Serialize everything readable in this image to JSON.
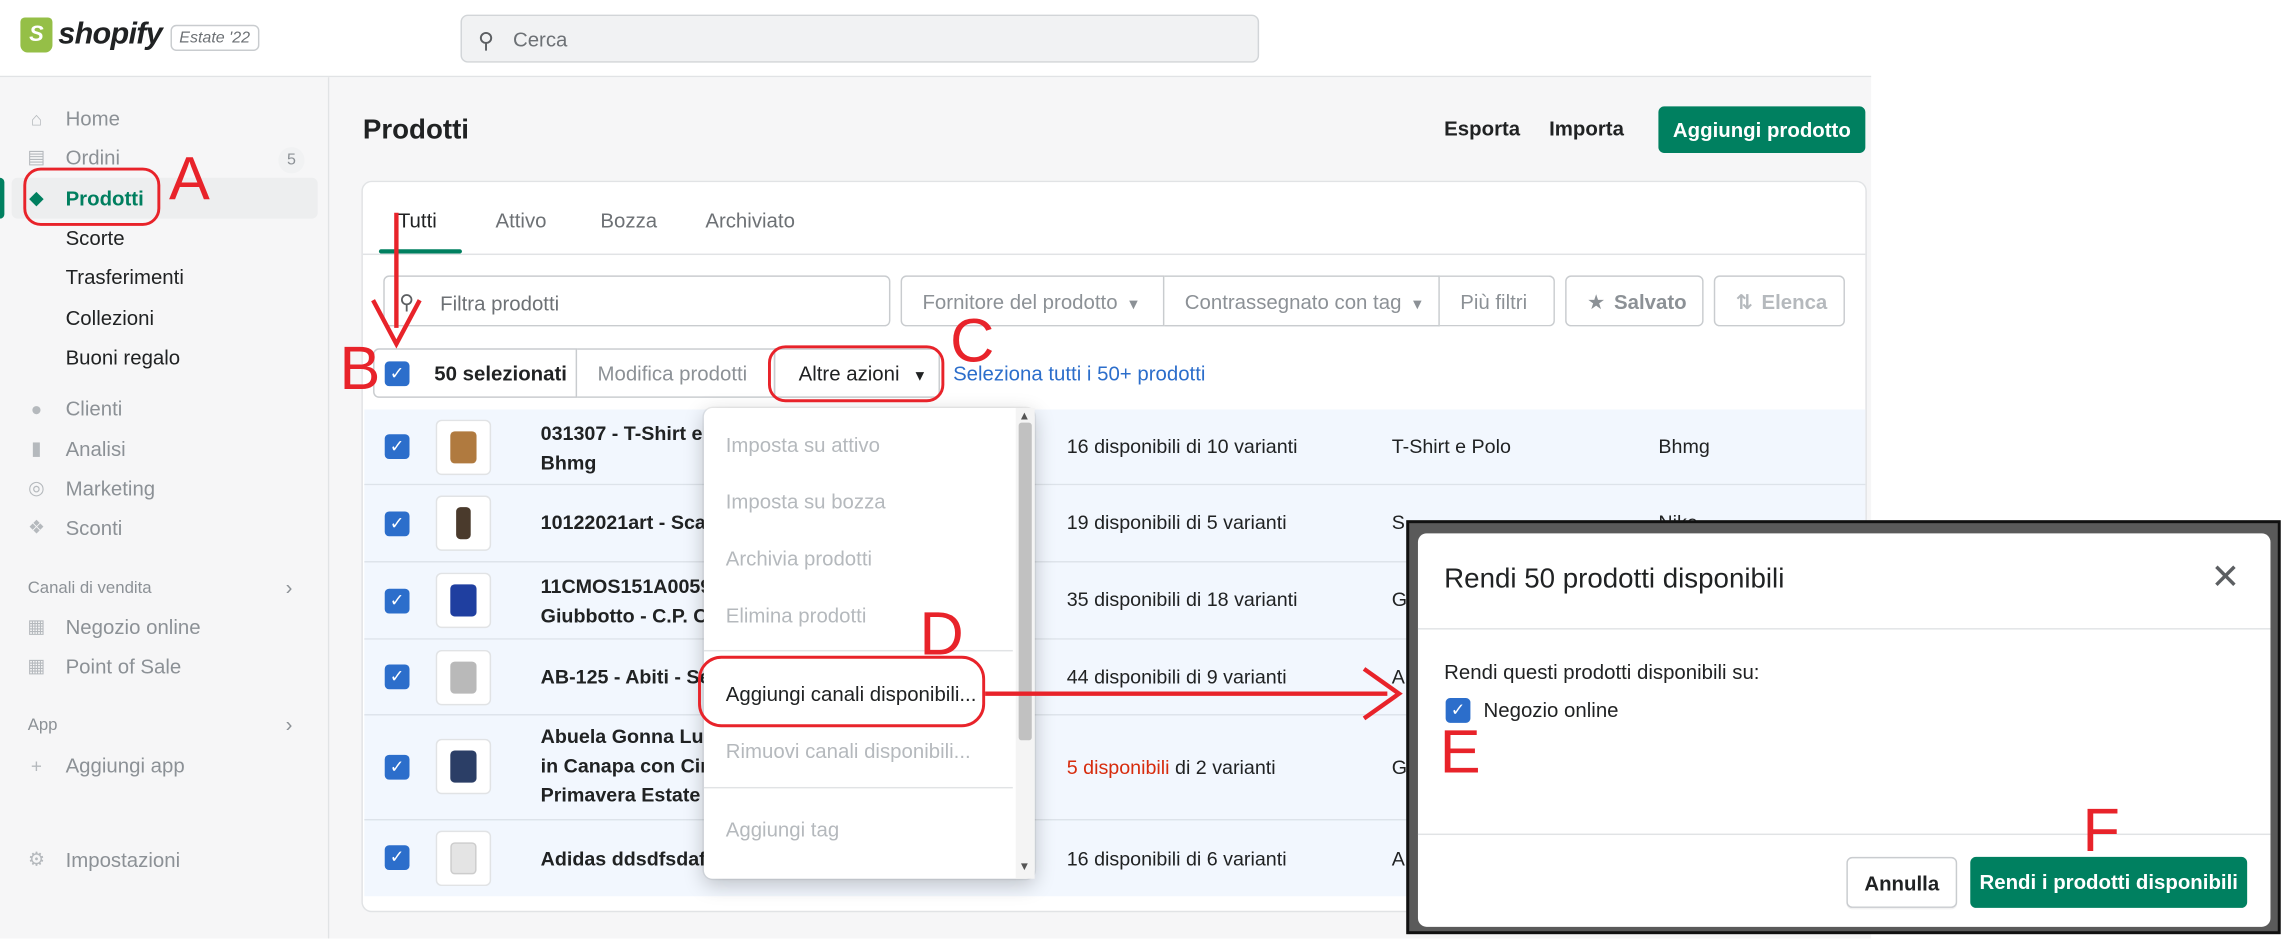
{
  "header": {
    "brand": "shopify",
    "edition": "Estate '22",
    "search_placeholder": "Cerca"
  },
  "sidebar": {
    "items": [
      {
        "label": "Home",
        "icon": "home-icon"
      },
      {
        "label": "Ordini",
        "icon": "orders-icon",
        "count": "5"
      },
      {
        "label": "Prodotti",
        "icon": "tag-icon",
        "active": true
      },
      {
        "label": "Scorte"
      },
      {
        "label": "Trasferimenti"
      },
      {
        "label": "Collezioni"
      },
      {
        "label": "Buoni regalo"
      },
      {
        "label": "Clienti",
        "icon": "person-icon"
      },
      {
        "label": "Analisi",
        "icon": "bar-chart-icon"
      },
      {
        "label": "Marketing",
        "icon": "target-icon"
      },
      {
        "label": "Sconti",
        "icon": "discount-icon"
      }
    ],
    "sales_channels": {
      "title": "Canali di vendita",
      "items": [
        {
          "label": "Negozio online",
          "icon": "store-icon"
        },
        {
          "label": "Point of Sale",
          "icon": "pos-icon"
        }
      ]
    },
    "apps": {
      "title": "App",
      "add_label": "Aggiungi app"
    },
    "settings_label": "Impostazioni"
  },
  "page": {
    "title": "Prodotti",
    "export_label": "Esporta",
    "import_label": "Importa",
    "add_product_label": "Aggiungi prodotto",
    "tabs": [
      "Tutti",
      "Attivo",
      "Bozza",
      "Archiviato"
    ],
    "filter_placeholder": "Filtra prodotti",
    "filters": [
      "Fornitore del prodotto",
      "Contrassegnato con tag",
      "Più filtri"
    ],
    "saved_label": "Salvato",
    "sort_label": "Elenca",
    "bulk": {
      "selected": "50 selezionati",
      "edit": "Modifica prodotti",
      "more": "Altre azioni",
      "select_all": "Seleziona tutti i 50+ prodotti"
    },
    "rows": [
      {
        "name1": "031307 - T-Shirt e P",
        "name2": "Bhmg",
        "inv": "16 disponibili di 10 varianti",
        "type": "T-Shirt e Polo",
        "vendor": "Bhmg"
      },
      {
        "name1": "10122021art - Scarp",
        "name2": "",
        "inv": "19 disponibili di 5 varianti",
        "type": "S",
        "vendor": "Nike"
      },
      {
        "name1": "11CMOS151A00590",
        "name2": "Giubbotto - C.P. Co",
        "inv": "35 disponibili di 18 varianti",
        "type": "G",
        "vendor": ""
      },
      {
        "name1": "AB-125 - Abiti - Se",
        "name2": "",
        "inv": "44 disponibili di 9 varianti",
        "type": "A",
        "vendor": ""
      },
      {
        "name1": "Abuela Gonna Lun",
        "name2": "in Canapa con Cint",
        "name3": "Primavera Estate",
        "inv_red": "5 disponibili",
        "inv_rest": " di 2 varianti",
        "type": "G",
        "vendor": ""
      },
      {
        "name1": "Adidas ddsdfsdaf",
        "name2": "",
        "inv": "16 disponibili di 6 varianti",
        "type": "A",
        "vendor": ""
      }
    ]
  },
  "dropdown": {
    "items": [
      "Imposta su attivo",
      "Imposta su bozza",
      "Archivia prodotti",
      "Elimina prodotti",
      "Aggiungi canali disponibili...",
      "Rimuovi canali disponibili...",
      "Aggiungi tag"
    ]
  },
  "modal": {
    "title": "Rendi 50 prodotti disponibili",
    "label": "Rendi questi prodotti disponibili su:",
    "option": "Negozio online",
    "cancel": "Annulla",
    "confirm": "Rendi i prodotti disponibili"
  },
  "annotations": {
    "a": "A",
    "b": "B",
    "c": "C",
    "d": "D",
    "e": "E",
    "f": "F"
  },
  "colors": {
    "brand_green": "#008060",
    "checkbox_blue": "#2c6ecb",
    "annotation_red": "#e8232a",
    "warning_red": "#d72c0d"
  }
}
